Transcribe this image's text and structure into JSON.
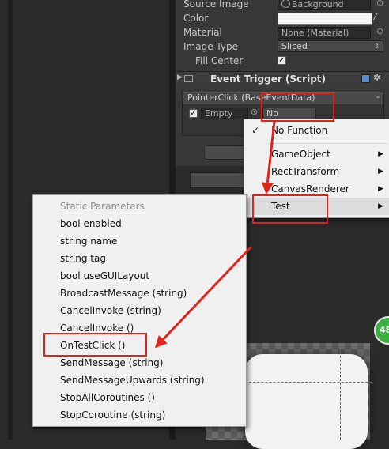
{
  "inspector": {
    "rows": [
      {
        "label": "Source Image",
        "value": "Background"
      },
      {
        "label": "Color",
        "value": ""
      },
      {
        "label": "Material",
        "value": "None (Material)"
      },
      {
        "label": "Image Type",
        "value": "Sliced"
      },
      {
        "label": "Fill Center",
        "value": ""
      }
    ],
    "event_trigger": {
      "title": "Event Trigger (Script)",
      "entry_header": "PointerClick (BaseEventData)",
      "target_value": "Empty",
      "function_value": "No Function"
    }
  },
  "function_menu": {
    "items": [
      {
        "label": "No Function",
        "checked": true
      },
      {
        "label": "GameObject"
      },
      {
        "label": "RectTransform"
      },
      {
        "label": "CanvasRenderer"
      },
      {
        "label": "Test"
      }
    ]
  },
  "submenu": {
    "header": "Static Parameters",
    "items": [
      "bool enabled",
      "string name",
      "string tag",
      "bool useGUILayout",
      "BroadcastMessage (string)",
      "CancelInvoke (string)",
      "CancelInvoke ()",
      "OnTestClick ()",
      "SendMessage (string)",
      "SendMessageUpwards (string)",
      "StopAllCoroutines ()",
      "StopCoroutine (string)"
    ]
  },
  "badge": {
    "text": "48"
  },
  "colors": {
    "highlight_box": "#e2231a",
    "badge": "#3cb043"
  }
}
